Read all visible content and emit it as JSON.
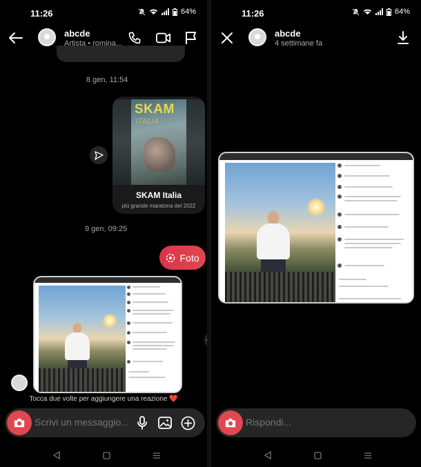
{
  "status": {
    "time": "11:26",
    "battery": "64%"
  },
  "left": {
    "header": {
      "name": "abcde",
      "subtitle": "Artista • romina..."
    },
    "timestamps": [
      "8 gen, 11:54",
      "9 gen, 09:25"
    ],
    "shared_post": {
      "poster_title": "SKAM",
      "poster_subtitle": "ITALIA",
      "title": "SKAM Italia",
      "subtitle": "più grande maratona del 2022"
    },
    "photo_bubble_label": "Foto",
    "tap_hint": "Tocca due volte per aggiungere una reazione ❤️",
    "composer_placeholder": "Scrivi un messaggio..."
  },
  "right": {
    "header": {
      "name": "abcde",
      "subtitle": "4 settimane fa"
    },
    "reply_placeholder": "Rispondi..."
  },
  "icons": {
    "back": "arrow-left-icon",
    "call": "phone-icon",
    "video": "video-camera-icon",
    "report": "flag-icon",
    "close": "close-icon",
    "download": "download-icon",
    "camera": "camera-icon",
    "mic": "microphone-icon",
    "gallery": "image-icon",
    "add": "plus-circle-icon"
  },
  "colors": {
    "accent": "#e0474f",
    "background": "#000000",
    "bubble": "#262626",
    "muted_text": "#a8a8a8"
  }
}
